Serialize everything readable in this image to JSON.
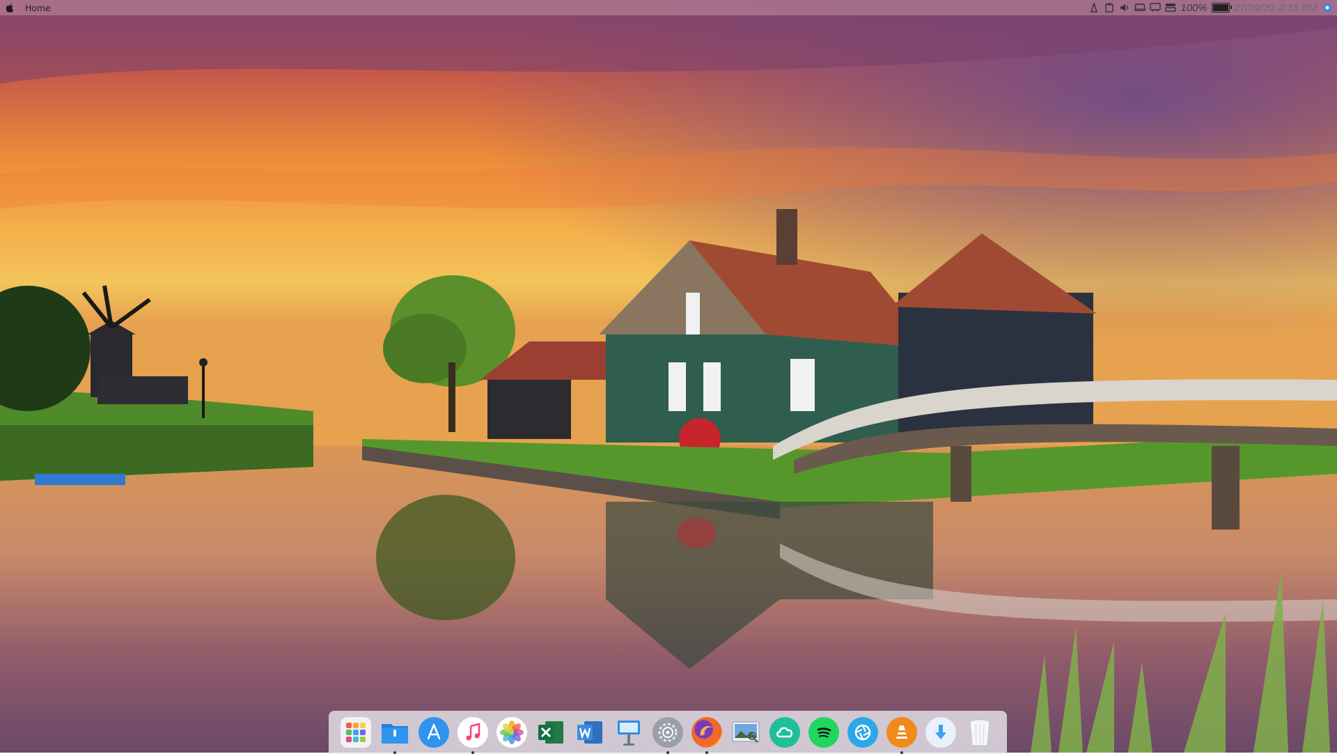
{
  "menubar": {
    "app_name": "Home",
    "battery_percent_label": "100%",
    "battery_level": 1.0,
    "date": "27/09/20",
    "time": "2:15 PM",
    "tray_icons": [
      "accessibility-icon",
      "clipboard-icon",
      "volume-icon",
      "drive-icon",
      "display-icon",
      "wifi-icon"
    ]
  },
  "dock": {
    "items": [
      {
        "name": "launchpad",
        "icon": "grid-icon",
        "running": false
      },
      {
        "name": "files",
        "icon": "folder-icon",
        "running": true
      },
      {
        "name": "app-store",
        "icon": "app-store-icon",
        "running": false
      },
      {
        "name": "music",
        "icon": "music-note-icon",
        "running": true
      },
      {
        "name": "photos",
        "icon": "photos-flower-icon",
        "running": false
      },
      {
        "name": "excel",
        "icon": "excel-icon",
        "running": false
      },
      {
        "name": "word",
        "icon": "word-icon",
        "running": false
      },
      {
        "name": "keynote",
        "icon": "keynote-icon",
        "running": false
      },
      {
        "name": "system-preferences",
        "icon": "gear-icon",
        "running": true
      },
      {
        "name": "firefox",
        "icon": "firefox-icon",
        "running": true
      },
      {
        "name": "image-viewer",
        "icon": "image-viewer-icon",
        "running": false
      },
      {
        "name": "cloud-drive",
        "icon": "cloud-icon",
        "running": false
      },
      {
        "name": "spotify",
        "icon": "spotify-icon",
        "running": false
      },
      {
        "name": "shotwell",
        "icon": "aperture-icon",
        "running": false
      },
      {
        "name": "vlc",
        "icon": "traffic-cone-icon",
        "running": true
      },
      {
        "name": "downloads",
        "icon": "download-arrow-icon",
        "running": false
      },
      {
        "name": "trash",
        "icon": "trash-icon",
        "running": false
      }
    ]
  },
  "colors": {
    "sky_top": "#8a4b7a",
    "sky_orange": "#f0973a",
    "sky_yellow": "#f6c24a",
    "house_green": "#2f5d4e",
    "roof_red": "#a14a33",
    "water": "#c9865f",
    "grass": "#4f8b2b"
  }
}
